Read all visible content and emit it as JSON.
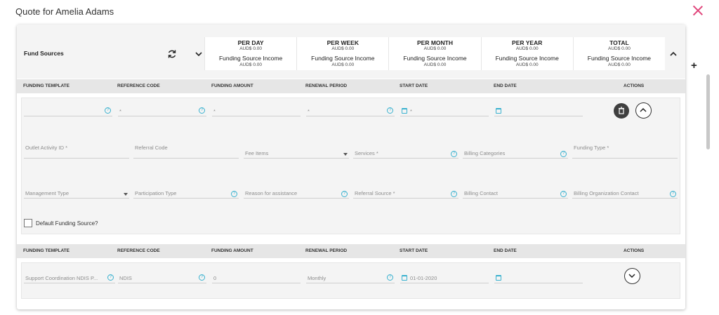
{
  "modal": {
    "title": "Quote for Amelia Adams"
  },
  "fund_sources": {
    "title": "Fund Sources",
    "summary": [
      {
        "period": "PER DAY",
        "amount": "AUD$ 0.00",
        "income_label": "Funding Source Income",
        "income": "AUD$ 0.00"
      },
      {
        "period": "PER WEEK",
        "amount": "AUD$ 0.00",
        "income_label": "Funding Source Income",
        "income": "AUD$ 0.00"
      },
      {
        "period": "PER MONTH",
        "amount": "AUD$ 0.00",
        "income_label": "Funding Source Income",
        "income": "AUD$ 0.00"
      },
      {
        "period": "PER YEAR",
        "amount": "AUD$ 0.00",
        "income_label": "Funding Source Income",
        "income": "AUD$ 0.00"
      },
      {
        "period": "TOTAL",
        "amount": "AUD$ 0.00",
        "income_label": "Funding Source Income",
        "income": "AUD$ 0.00"
      }
    ]
  },
  "columns": [
    "FUNDING TEMPLATE",
    "REFERENCE CODE",
    "FUNDING AMOUNT",
    "RENEWAL PERIOD",
    "START DATE",
    "END DATE",
    "ACTIONS"
  ],
  "row1": {
    "funding_template": "",
    "reference_code": "*",
    "funding_amount": "*",
    "renewal_period": "*",
    "start_date": "*",
    "end_date": "",
    "details": {
      "outlet_activity_id": "Outlet Activity ID *",
      "referral_code": "Referral Code",
      "fee_items": "Fee Items",
      "services": "Services *",
      "billing_categories": "Billing Categories",
      "funding_type": "Funding Type *",
      "management_type": "Management Type",
      "participation_type": "Participation Type",
      "reason_for_assistance": "Reason for assistance",
      "referral_source": "Referral Source *",
      "billing_contact": "Billing Contact",
      "billing_org_contact": "Billing Organization Contact",
      "default_label": "Default Funding Source?"
    }
  },
  "row2": {
    "funding_template": "Support Coordination NDIS P...",
    "reference_code": "NDIS",
    "funding_amount": "0",
    "renewal_period": "Monthly",
    "start_date": "01-01-2020",
    "end_date": ""
  },
  "icons": {
    "close": "close-icon",
    "refresh": "refresh-icon",
    "chevron_down": "chevron-down-icon",
    "chevron_up": "chevron-up-icon",
    "info": "info-icon",
    "calendar": "calendar-icon",
    "trash": "trash-icon",
    "plus": "plus-icon"
  },
  "colors": {
    "accent": "#39b1cf",
    "close": "#e0457b"
  }
}
